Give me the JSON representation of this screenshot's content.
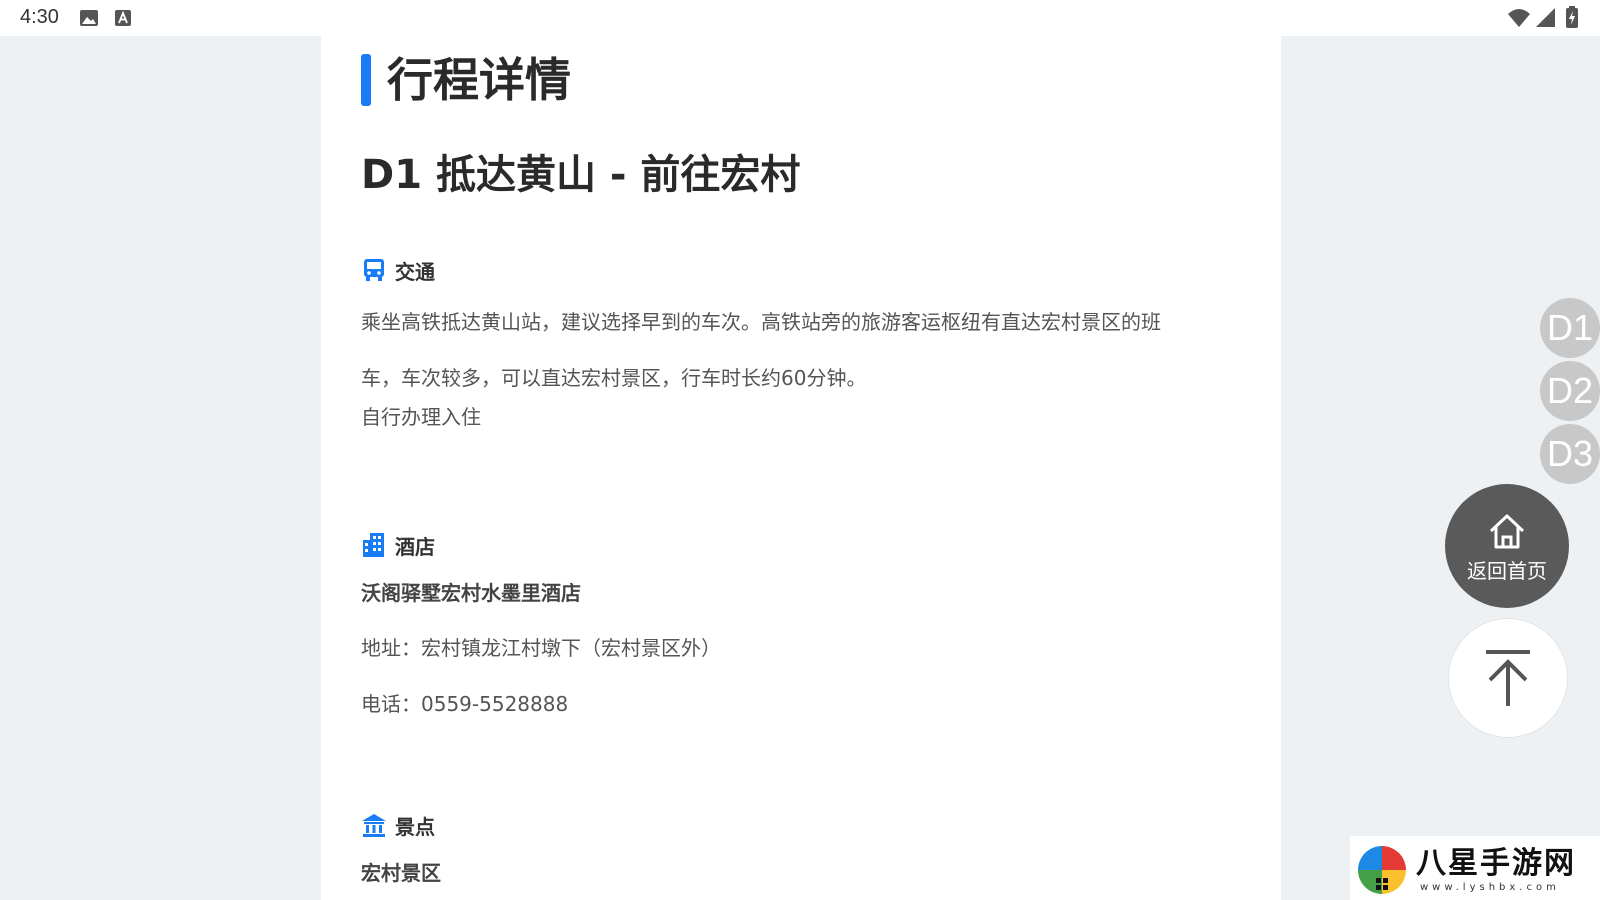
{
  "status_bar": {
    "time": "4:30",
    "icons_left": [
      "image-icon",
      "a-keyboard-icon"
    ],
    "icons_right": [
      "wifi-icon",
      "signal-icon",
      "battery-charging-icon"
    ]
  },
  "page": {
    "title": "行程详情",
    "accent_color": "#1a7cf5"
  },
  "day": {
    "title": "D1 抵达黄山 - 前往宏村",
    "sections": {
      "transport": {
        "label": "交通",
        "icon": "bus-icon",
        "text_line1": "乘坐高铁抵达黄山站，建议选择早到的车次。高铁站旁的旅游客运枢纽有直达宏村景区的班",
        "text_line2": "车，车次较多，可以直达宏村景区，行车时长约60分钟。",
        "note": "自行办理入住"
      },
      "hotel": {
        "label": "酒店",
        "icon": "building-icon",
        "name": "沃阁驿墅宏村水墨里酒店",
        "address": "地址：宏村镇龙江村墩下（宏村景区外）",
        "phone": "电话：0559-5528888"
      },
      "attraction": {
        "label": "景点",
        "icon": "landmark-icon",
        "name": "宏村景区"
      }
    }
  },
  "side_nav": {
    "days": [
      "D1",
      "D2",
      "D3"
    ],
    "home_label": "返回首页",
    "top_icon": "arrow-up-icon"
  },
  "watermark": {
    "text": "八星手游网",
    "url": "www.lyshbx.com"
  }
}
